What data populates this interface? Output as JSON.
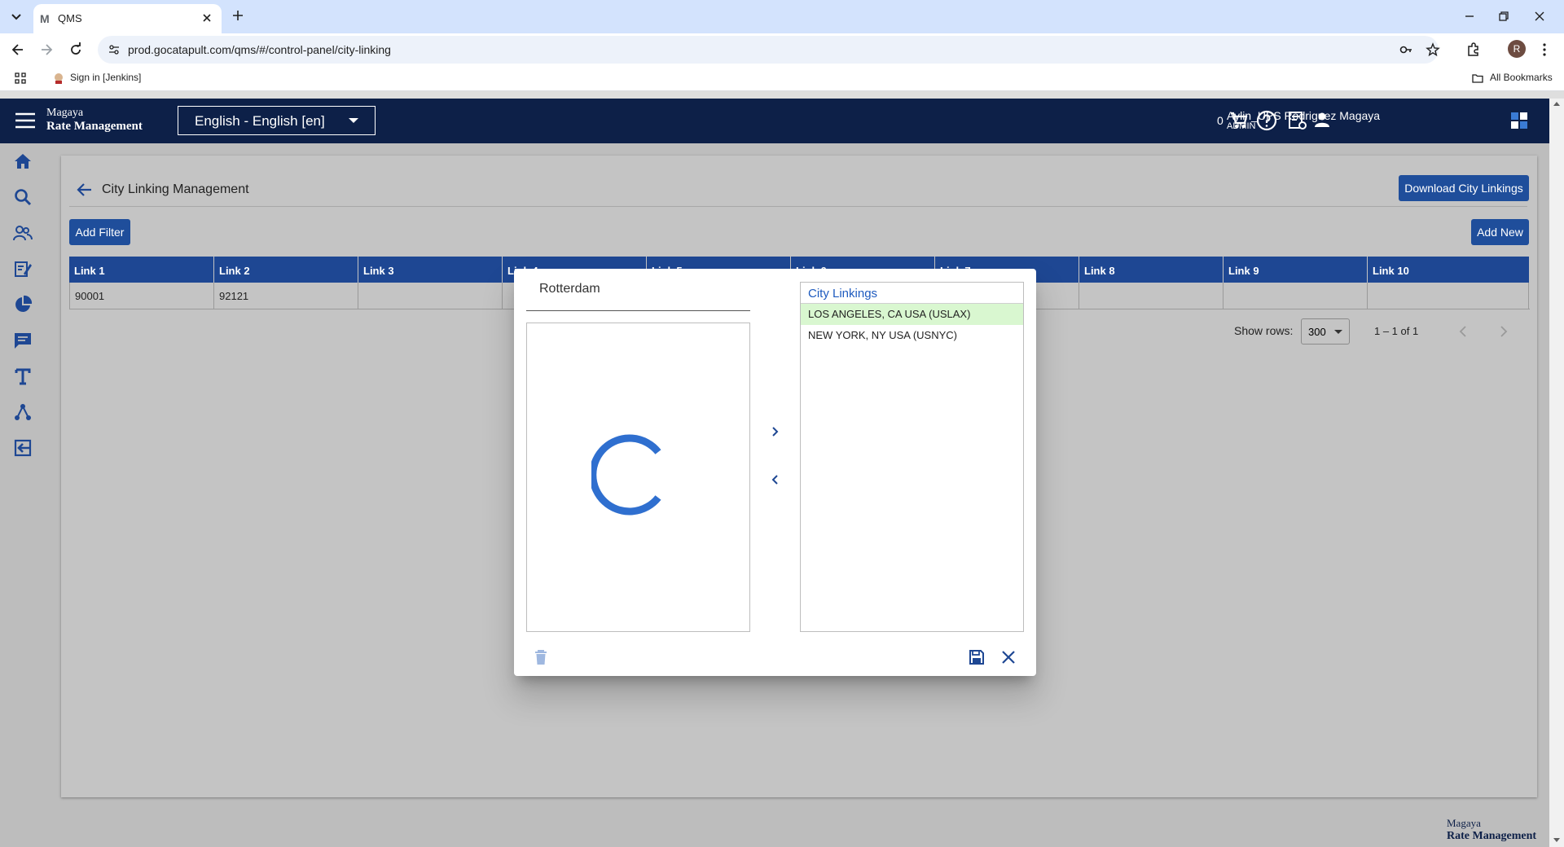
{
  "browser": {
    "tab_title": "QMS",
    "tab_favicon": "M",
    "url": "prod.gocatapult.com/qms/#/control-panel/city-linking",
    "profile_initial": "R",
    "bookmark_sign_in": "Sign in [Jenkins]",
    "bookmark_all": "All Bookmarks"
  },
  "header": {
    "brand_line1": "Magaya",
    "brand_line2": "Rate Management",
    "language": "English - English [en]",
    "cart_count": "0",
    "user_name": "Aylin_UPS Rodriguez Magaya",
    "user_role": "ADMIN"
  },
  "page": {
    "title": "City Linking Management",
    "download_button": "Download City Linkings",
    "add_filter_button": "Add Filter",
    "add_new_button": "Add New"
  },
  "grid": {
    "columns": [
      "Link 1",
      "Link 2",
      "Link 3",
      "Link 4",
      "Link 5",
      "Link 6",
      "Link 7",
      "Link 8",
      "Link 9",
      "Link 10"
    ],
    "rows": [
      [
        "90001",
        "92121",
        "",
        "",
        "",
        "",
        "",
        "",
        "",
        ""
      ]
    ]
  },
  "pager": {
    "show_rows_label": "Show rows:",
    "rows_value": "300",
    "range": "1 – 1 of 1"
  },
  "footer": {
    "brand_line1": "Magaya",
    "brand_line2": "Rate Management"
  },
  "dialog": {
    "title": "Rotterdam",
    "linkings_header": "City Linkings",
    "linkings": [
      {
        "label": "LOS ANGELES, CA USA (USLAX)",
        "selected": true
      },
      {
        "label": "NEW YORK, NY USA (USNYC)",
        "selected": false
      }
    ]
  },
  "colors": {
    "header_bg": "#0d2048",
    "accent": "#1f4e9b",
    "grid_header": "#1e4793",
    "selected_row": "#d9f7d0",
    "link_text": "#1e5bbf"
  }
}
